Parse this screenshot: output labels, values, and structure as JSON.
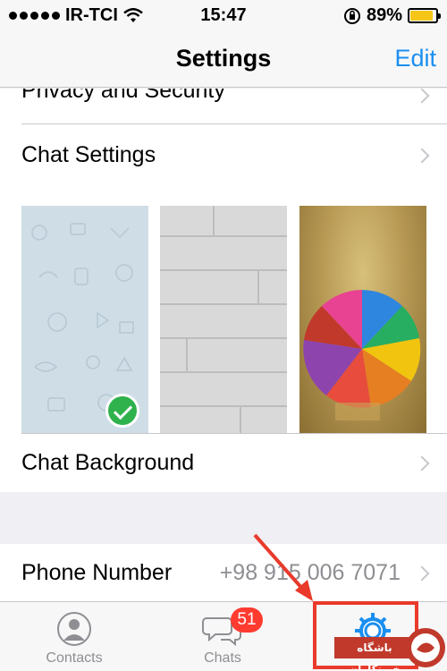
{
  "status": {
    "carrier": "IR-TCI",
    "time": "15:47",
    "battery": "89%",
    "battery_level": 0.89
  },
  "nav": {
    "title": "Settings",
    "edit_label": "Edit"
  },
  "rows": {
    "privacy_label": "Privacy and Security",
    "chat_settings_label": "Chat Settings",
    "chat_background_label": "Chat Background",
    "phone_label": "Phone Number",
    "phone_value": "+98 915 006 7071"
  },
  "tabs": [
    {
      "label": "Contacts"
    },
    {
      "label": "Chats",
      "badge": "51"
    },
    {
      "label": "Settings"
    }
  ],
  "colors": {
    "accent": "#1a8ff0",
    "badge": "#ff3b30",
    "highlight": "#e93a2b",
    "selected_check": "#2fb24c"
  },
  "logo": {
    "text": "باشگاه خبرنگاران"
  }
}
